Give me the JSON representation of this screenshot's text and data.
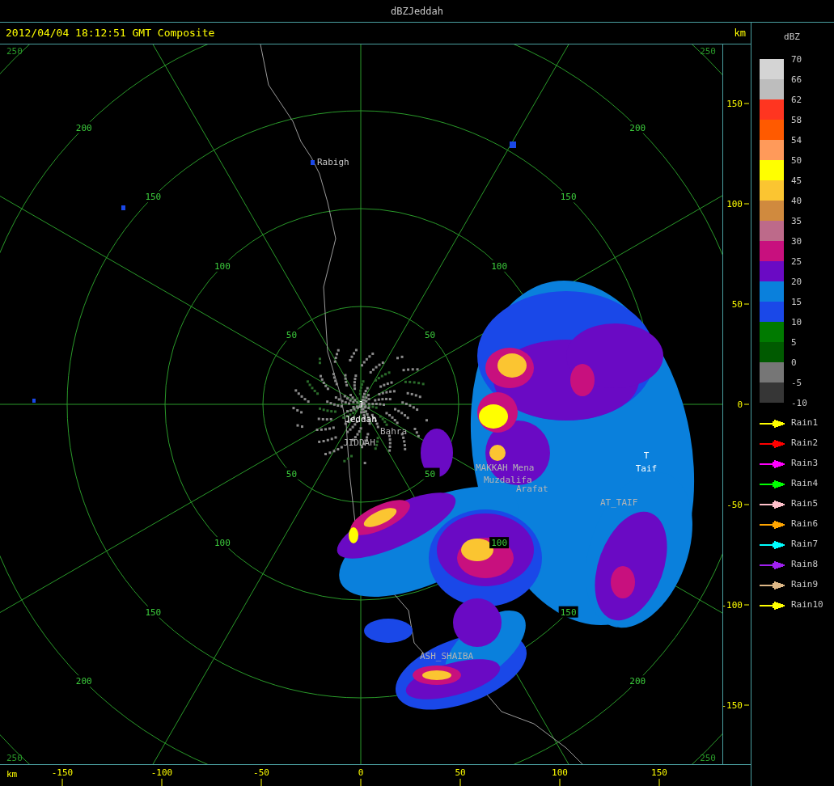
{
  "window": {
    "title": "dBZJeddah"
  },
  "header": {
    "caption": "2012/04/04 18:12:51 GMT Composite",
    "unit": "km"
  },
  "plot": {
    "corner_labels": [
      "250",
      "250",
      "250",
      "250"
    ],
    "ring_labels": {
      "nw": [
        "50",
        "100",
        "150",
        "200"
      ],
      "ne": [
        "50",
        "100",
        "150",
        "200"
      ],
      "sw": [
        "50",
        "100",
        "150",
        "200"
      ],
      "se": [
        "50",
        "100",
        "150",
        "200"
      ]
    },
    "places": [
      {
        "label": "Rabigh",
        "kind": "site"
      },
      {
        "label": "J",
        "kind": "radar"
      },
      {
        "label": "Jeddah",
        "kind": "radar"
      },
      {
        "label": "Bahra",
        "kind": "town"
      },
      {
        "label": "JIDDAH",
        "kind": "town"
      },
      {
        "label": "MAKKAH",
        "kind": "town"
      },
      {
        "label": "Mena",
        "kind": "town"
      },
      {
        "label": "Muzdalifa",
        "kind": "town"
      },
      {
        "label": "Arafat",
        "kind": "town"
      },
      {
        "label": "T",
        "kind": "radar"
      },
      {
        "label": "Taif",
        "kind": "radar"
      },
      {
        "label": "AT_TAIF",
        "kind": "town"
      },
      {
        "label": "ASH_SHAIBA",
        "kind": "town"
      }
    ]
  },
  "y_axis": {
    "ticks": [
      "150",
      "100",
      "50",
      "0",
      "-50",
      "-100",
      "-150"
    ]
  },
  "x_axis": {
    "unit": "km",
    "ticks": [
      "-150",
      "-100",
      "-50",
      "0",
      "50",
      "100",
      "150"
    ]
  },
  "legend": {
    "title": "dBZ",
    "ticks": [
      "70",
      "66",
      "62",
      "58",
      "54",
      "50",
      "45",
      "40",
      "35",
      "30",
      "25",
      "20",
      "15",
      "10",
      "5",
      "0",
      "-5",
      "-10"
    ],
    "bands": [
      {
        "color": "#d4d4d4"
      },
      {
        "color": "#bdbdbd"
      },
      {
        "color": "#ff3520"
      },
      {
        "color": "#ff5a00"
      },
      {
        "color": "#ff9a5a"
      },
      {
        "color": "#ffff00"
      },
      {
        "color": "#fbc531"
      },
      {
        "color": "#d08a3e"
      },
      {
        "color": "#bd6a8a"
      },
      {
        "color": "#c8107e"
      },
      {
        "color": "#6a0ac4"
      },
      {
        "color": "#0a80dc"
      },
      {
        "color": "#1a48e8"
      },
      {
        "color": "#007a00"
      },
      {
        "color": "#005a00"
      },
      {
        "color": "#767676"
      },
      {
        "color": "#363636"
      }
    ],
    "tracks": [
      {
        "label": "Rain1",
        "color": "#ffff00"
      },
      {
        "label": "Rain2",
        "color": "#ff0000"
      },
      {
        "label": "Rain3",
        "color": "#ff00ff"
      },
      {
        "label": "Rain4",
        "color": "#00ff00"
      },
      {
        "label": "Rain5",
        "color": "#ffc0cb"
      },
      {
        "label": "Rain6",
        "color": "#ffa500"
      },
      {
        "label": "Rain7",
        "color": "#00ffff"
      },
      {
        "label": "Rain8",
        "color": "#a020f0"
      },
      {
        "label": "Rain9",
        "color": "#deb887"
      },
      {
        "label": "Rain10",
        "color": "#ffff00"
      }
    ]
  }
}
